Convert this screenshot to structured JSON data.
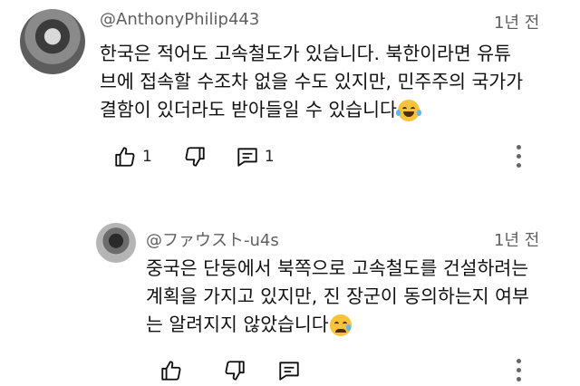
{
  "comments": [
    {
      "author": "@AnthonyPhilip443",
      "time": "1년 전",
      "lines": [
        "한국은 적어도 고속철도가 있습니다. 북한이라면 유튜",
        "브에 접속할 수조차 없을 수도 있지만, 민주주의 국가가",
        "결함이 있더라도 받아들일 수 있습니다"
      ],
      "emoji": "laughing-tears-emoji",
      "likes": "1",
      "replies": "1"
    },
    {
      "author": "@ファウスト-u4s",
      "time": "1년 전",
      "lines": [
        "중국은 단둥에서 북쪽으로 고속철도를 건설하려는",
        "계획을 가지고 있지만, 진 장군이 동의하는지 여부",
        "는 알려지지 않았습니다"
      ],
      "emoji": "crying-face-emoji"
    }
  ],
  "icons": [
    "like-icon",
    "dislike-icon",
    "reply-icon",
    "more-vert-icon"
  ]
}
